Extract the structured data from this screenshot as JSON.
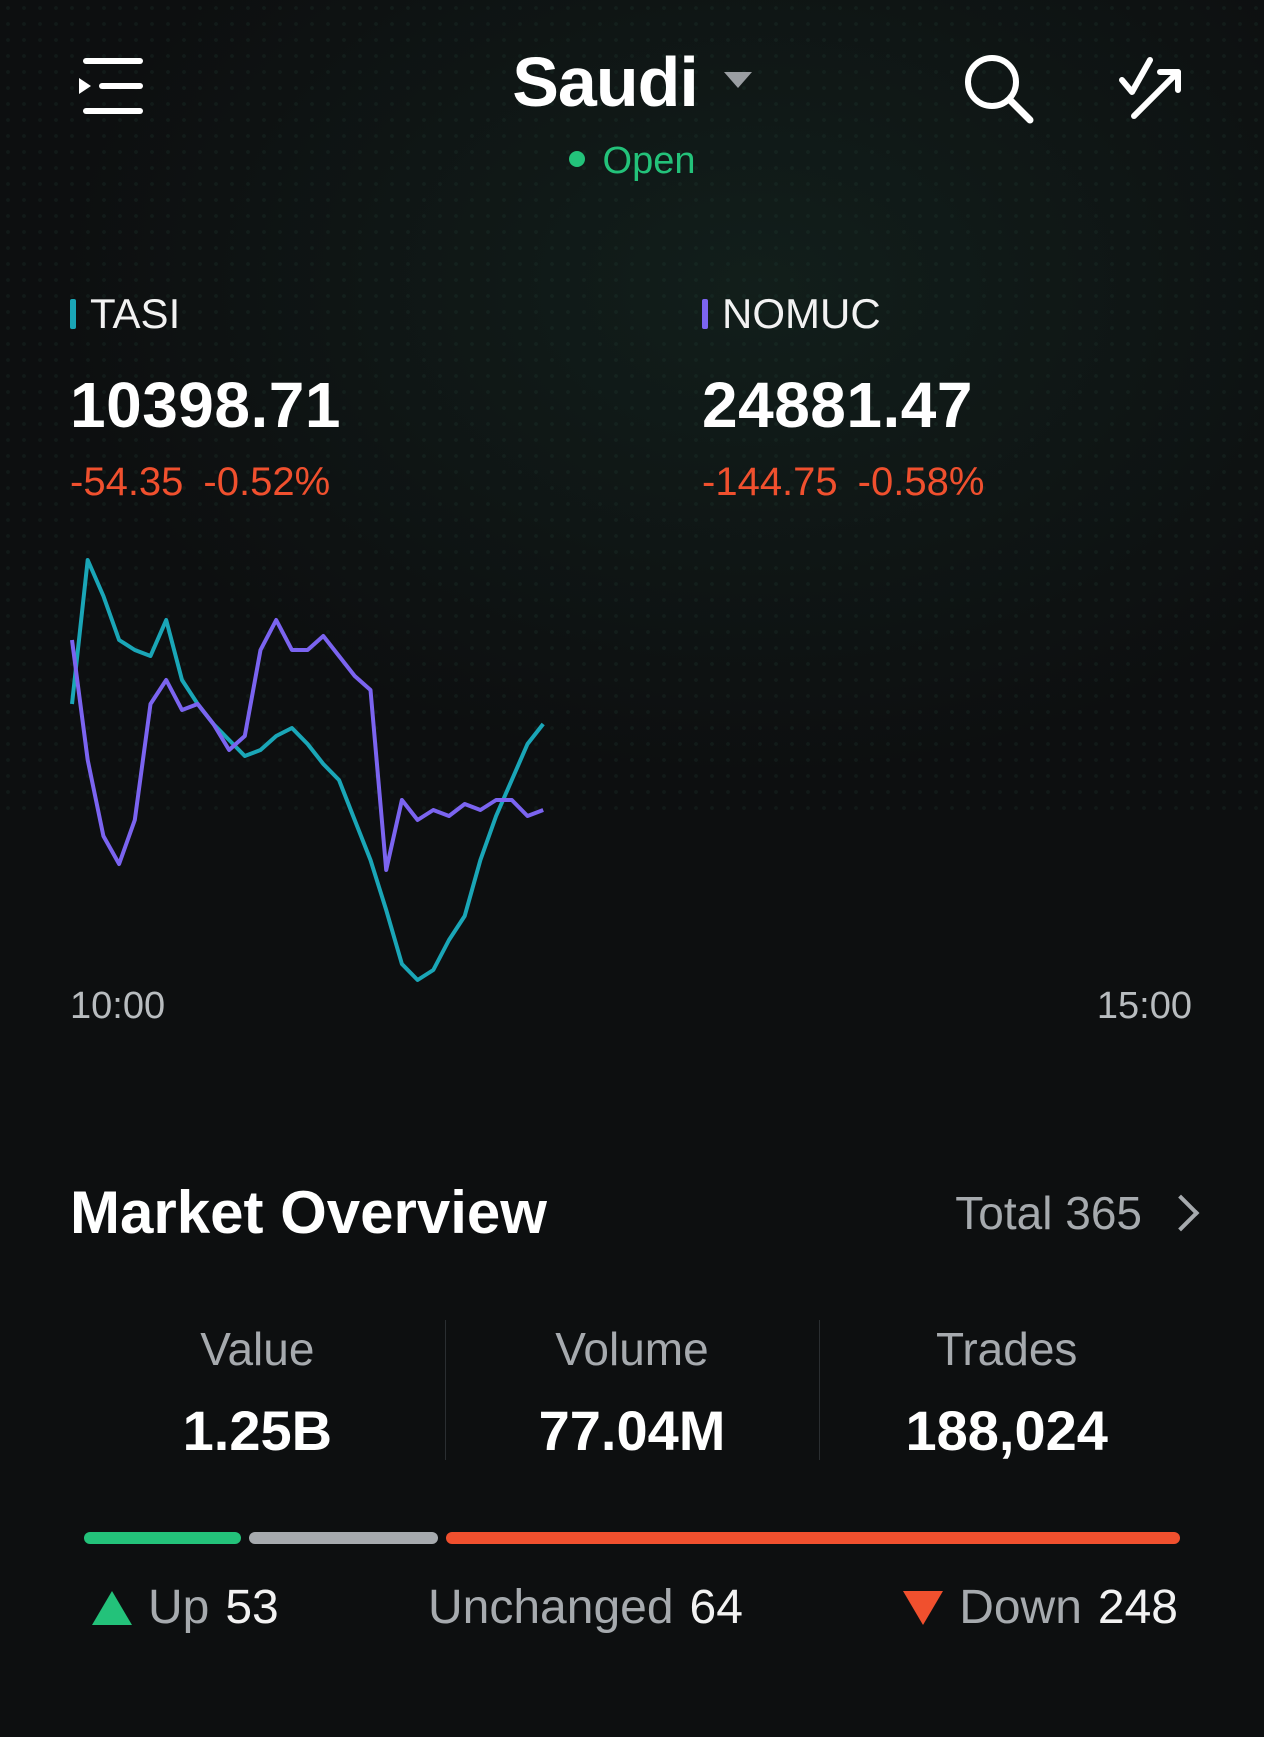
{
  "header": {
    "menu_icon": "menu-list-icon",
    "market_name": "Saudi",
    "dropdown_icon": "caret-down-icon",
    "status_text": "Open",
    "search_icon": "search-icon",
    "trend_icon": "check-trend-icon"
  },
  "indices": [
    {
      "name": "TASI",
      "value": "10398.71",
      "change": "-54.35",
      "change_pct": "-0.52%",
      "color": "#1aa6b7"
    },
    {
      "name": "NOMUC",
      "value": "24881.47",
      "change": "-144.75",
      "change_pct": "-0.58%",
      "color": "#7b64f0"
    }
  ],
  "chart": {
    "time_start": "10:00",
    "time_end": "15:00"
  },
  "chart_data": {
    "type": "line",
    "series": [
      {
        "name": "TASI",
        "color": "#1aa6b7",
        "values": [
          0.28,
          1.0,
          0.82,
          0.6,
          0.55,
          0.52,
          0.7,
          0.4,
          0.28,
          0.18,
          0.1,
          0.02,
          0.05,
          0.12,
          0.16,
          0.08,
          -0.02,
          -0.1,
          -0.3,
          -0.5,
          -0.75,
          -1.02,
          -1.1,
          -1.05,
          -0.9,
          -0.78,
          -0.5,
          -0.28,
          -0.1,
          0.08,
          0.18
        ]
      },
      {
        "name": "NOMUC",
        "color": "#7b64f0",
        "values": [
          0.6,
          0.0,
          -0.38,
          -0.52,
          -0.3,
          0.28,
          0.4,
          0.25,
          0.28,
          0.18,
          0.05,
          0.12,
          0.55,
          0.7,
          0.55,
          0.55,
          0.62,
          0.52,
          0.42,
          0.35,
          -0.55,
          -0.2,
          -0.3,
          -0.25,
          -0.28,
          -0.22,
          -0.25,
          -0.2,
          -0.2,
          -0.28,
          -0.25
        ]
      }
    ],
    "x_range": [
      "10:00",
      "15:00"
    ],
    "progress_fraction": 0.42
  },
  "overview": {
    "title": "Market Overview",
    "total_label": "Total 365",
    "chevron_icon": "chevron-right-icon",
    "stats": [
      {
        "label": "Value",
        "value": "1.25B"
      },
      {
        "label": "Volume",
        "value": "77.04M"
      },
      {
        "label": "Trades",
        "value": "188,024"
      }
    ]
  },
  "breadth": {
    "up": {
      "label": "Up",
      "count": "53",
      "value": 53,
      "color": "#23c27a"
    },
    "unchanged": {
      "label": "Unchanged",
      "count": "64",
      "value": 64,
      "color": "#a6aaae"
    },
    "down": {
      "label": "Down",
      "count": "248",
      "value": 248,
      "color": "#f0502e"
    }
  }
}
